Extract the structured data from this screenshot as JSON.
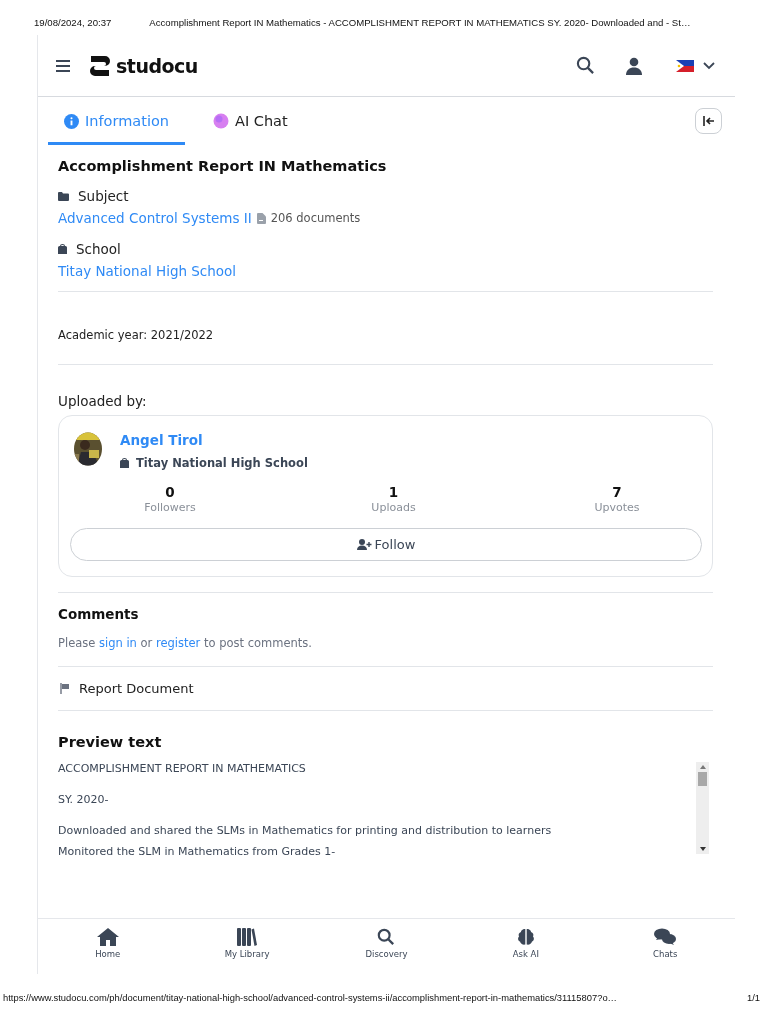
{
  "print_header": {
    "date": "19/08/2024, 20:37",
    "title": "Accomplishment Report IN Mathematics - ACCOMPLISHMENT REPORT IN MATHEMATICS SY. 2020- Downloaded and - St…"
  },
  "top_bar": {
    "logo": "studocu"
  },
  "tabs": [
    {
      "label": "Information",
      "selected": true,
      "kind": "info"
    },
    {
      "label": "AI Chat",
      "selected": false,
      "kind": "ai"
    }
  ],
  "document": {
    "title": "Accomplishment Report IN Mathematics",
    "subject_label": "Subject",
    "subject": "Advanced Control Systems II",
    "documents_count": "206 documents",
    "school_label": "School",
    "school": "Titay National High School",
    "academic_year": "Academic year: 2021/2022"
  },
  "uploader": {
    "heading": "Uploaded by:",
    "name": "Angel Tirol",
    "school": "Titay National High School",
    "stats": [
      {
        "value": "0",
        "label": "Followers"
      },
      {
        "value": "1",
        "label": "Uploads"
      },
      {
        "value": "7",
        "label": "Upvotes"
      }
    ],
    "follow_button": "Follow"
  },
  "comments": {
    "heading": "Comments",
    "before": "Please",
    "sign_in": "sign in",
    "middle": "or",
    "register": "register",
    "after": "to post comments."
  },
  "report": "Report Document",
  "preview": {
    "heading": "Preview text",
    "lines": [
      "ACCOMPLISHMENT REPORT IN MATHEMATICS",
      "SY. 2020-",
      "Downloaded and shared the SLMs in Mathematics for printing and distribution to learners",
      "Monitored the SLM in Mathematics from Grades 1-"
    ]
  },
  "bottom_nav": [
    {
      "label": "Home",
      "kind": "home"
    },
    {
      "label": "My Library",
      "kind": "library"
    },
    {
      "label": "Discovery",
      "kind": "search"
    },
    {
      "label": "Ask AI",
      "kind": "brain"
    },
    {
      "label": "Chats",
      "kind": "chat"
    }
  ],
  "print_footer": {
    "url": "https://www.studocu.com/ph/document/titay-national-high-school/advanced-control-systems-ii/accomplishment-report-in-mathematics/31115807?o…",
    "page": "1/1"
  }
}
